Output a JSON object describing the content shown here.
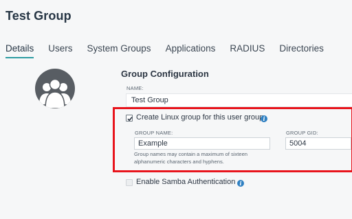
{
  "page": {
    "title": "Test Group"
  },
  "tabs": [
    {
      "label": "Details",
      "active": true
    },
    {
      "label": "Users"
    },
    {
      "label": "System Groups"
    },
    {
      "label": "Applications"
    },
    {
      "label": "RADIUS"
    },
    {
      "label": "Directories"
    }
  ],
  "avatar": {
    "icon": "group-avatar-icon"
  },
  "config": {
    "section_title": "Group Configuration",
    "name_label": "NAME:",
    "name_value": "Test Group",
    "linux_group": {
      "label": "Create Linux group for this user group",
      "checked": true,
      "group_name_label": "GROUP NAME:",
      "group_name_value": "Example",
      "gid_label": "GROUP GID:",
      "gid_value": "5004",
      "help_text": "Group names may contain a maximum of sixteen alphanumeric characters and hyphens."
    },
    "samba": {
      "label": "Enable Samba Authentication",
      "checked": false
    }
  },
  "colors": {
    "accent": "#2b9ba1",
    "highlight": "#e8141c",
    "info": "#2f80c2"
  }
}
